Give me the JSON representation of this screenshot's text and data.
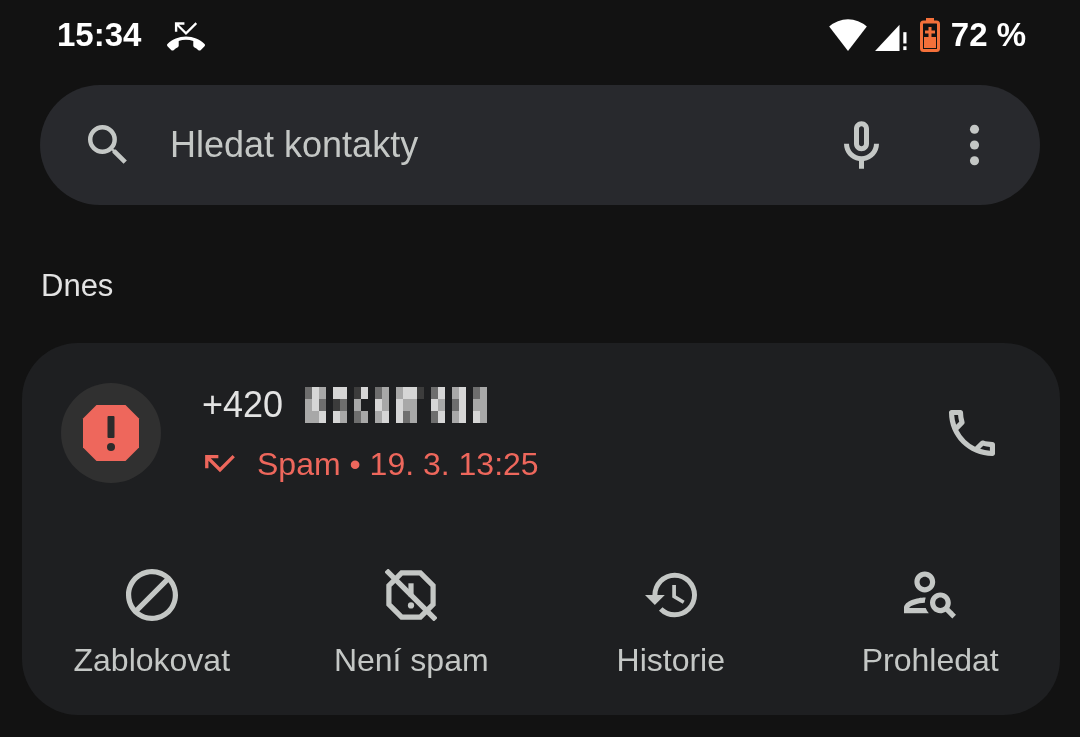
{
  "status_bar": {
    "time": "15:34",
    "battery": "72 %"
  },
  "search": {
    "placeholder": "Hledat kontakty"
  },
  "section": "Dnes",
  "calls": [
    {
      "number": "+420",
      "redacted": true,
      "spam": true,
      "status": "Spam • 19. 3. 13:25",
      "actions": [
        {
          "kind": "block",
          "label": "Zablokovat"
        },
        {
          "kind": "not_spam",
          "label": "Není spam"
        },
        {
          "kind": "history",
          "label": "Historie"
        },
        {
          "kind": "search_person",
          "label": "Prohledat"
        }
      ]
    }
  ]
}
